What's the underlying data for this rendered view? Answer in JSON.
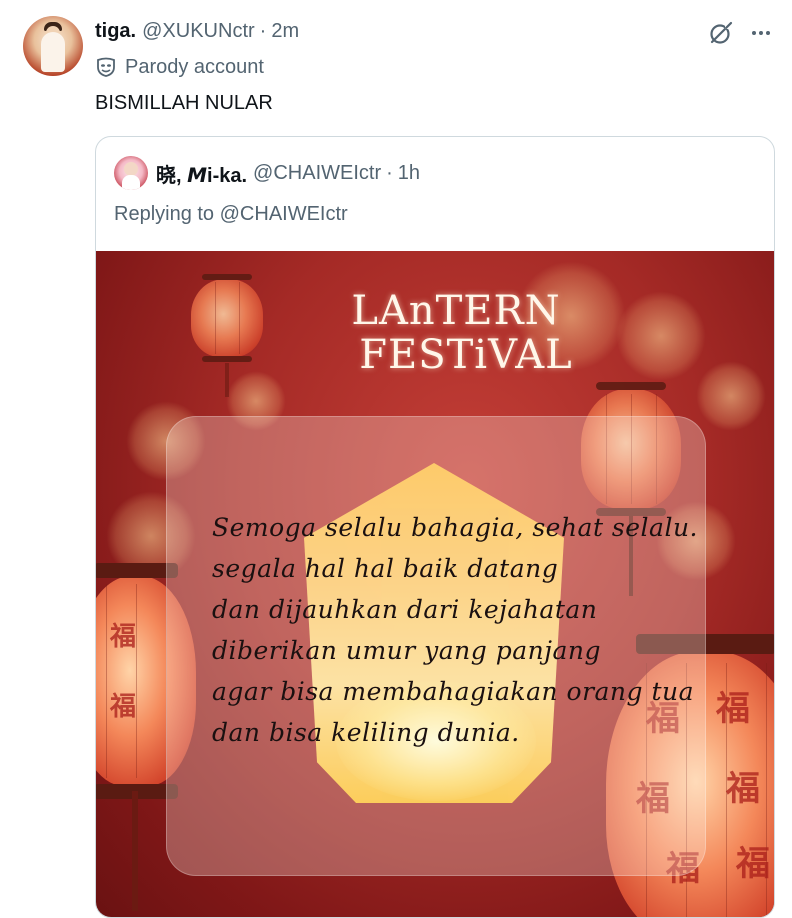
{
  "tweet": {
    "display_name": "tiga.",
    "handle": "@XUKUNctr",
    "separator": "·",
    "time": "2m",
    "parody_label": "Parody account",
    "text": "BISMILLAH NULAR"
  },
  "quote": {
    "display_name": "晓, 𝙈i-ka.",
    "handle": "@CHAIWEIctr",
    "separator": "·",
    "time": "1h",
    "replying_prefix": "Replying to",
    "replying_handle": "@CHAIWEIctr"
  },
  "media": {
    "title_line1": "LAnTERN",
    "title_line2": "FESTiVAL",
    "poem": [
      "Semoga selalu bahagia, sehat selalu.",
      "segala hal hal baik datang",
      "dan dijauhkan dari kejahatan",
      "diberikan umur yang panjang",
      "agar bisa membahagiakan orang tua",
      "dan bisa keliling dunia."
    ],
    "lantern_character": "福"
  },
  "icons": {
    "grok": "grok-icon",
    "more": "more-icon",
    "parody": "mask-icon"
  },
  "colors": {
    "text_primary": "#0f1419",
    "text_secondary": "#536471",
    "border": "#cfd9de",
    "media_red": "#a52a26"
  }
}
